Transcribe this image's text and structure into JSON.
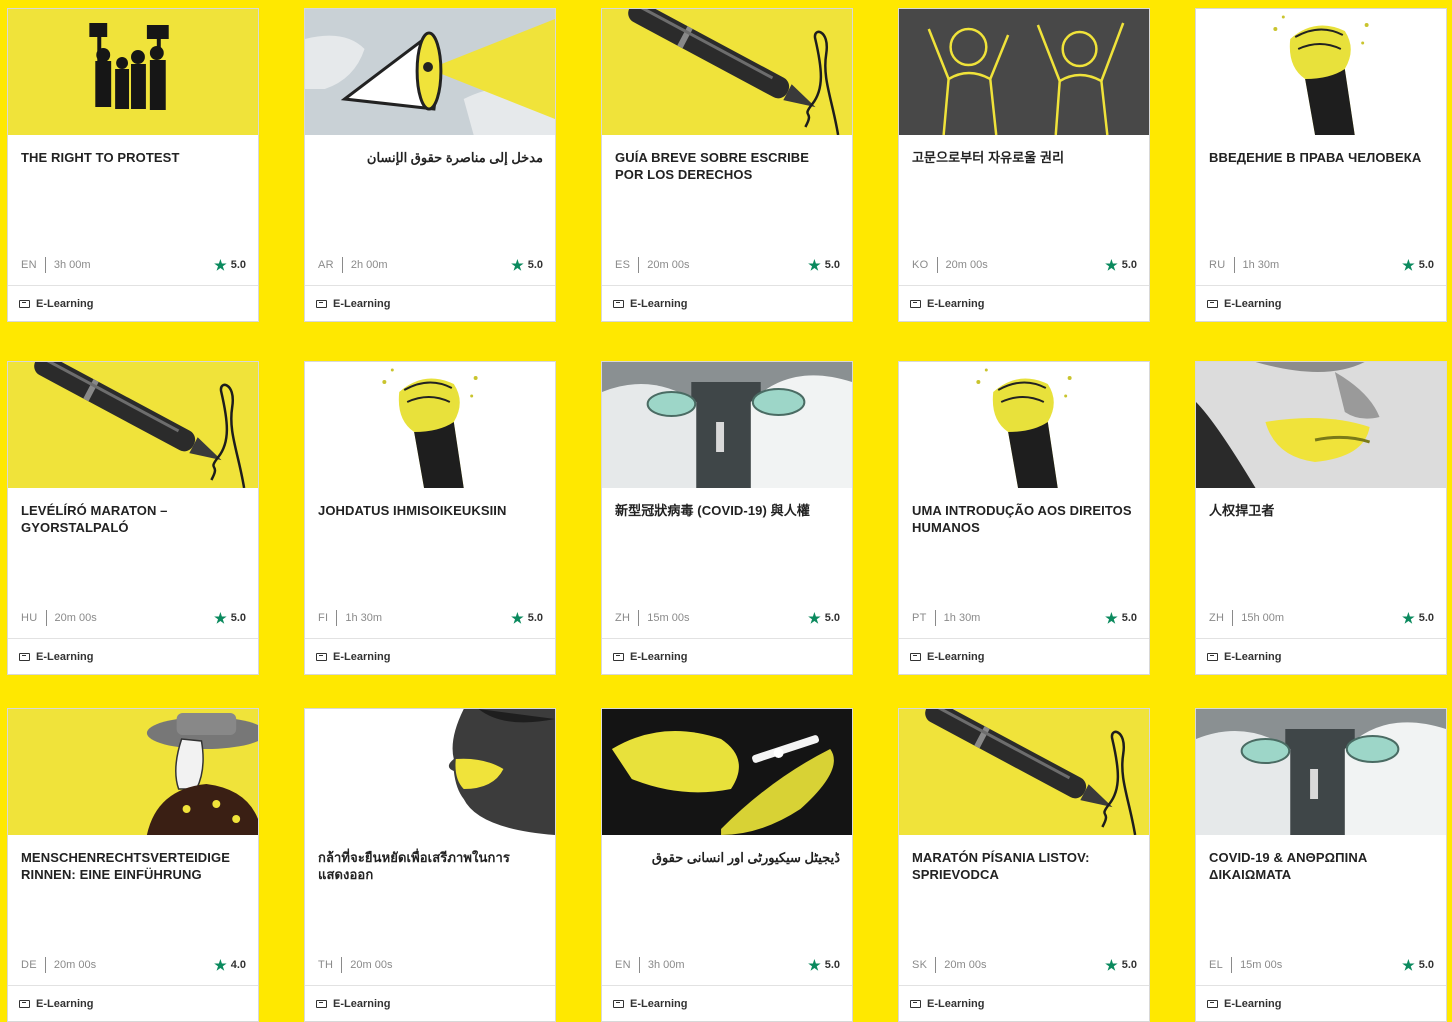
{
  "footer_label": "E-Learning",
  "colors": {
    "background": "#ffe800",
    "thumb_yellow": "#f0e33a",
    "star": "#0b8a5e"
  },
  "cards": [
    {
      "title": "THE RIGHT TO PROTEST",
      "lang": "EN",
      "duration": "3h 00m",
      "rating": "5.0",
      "image": "protesters-holding-signs"
    },
    {
      "title": "مدخل إلى مناصرة حقوق الإنسان",
      "lang": "AR",
      "duration": "2h 00m",
      "rating": "5.0",
      "image": "megaphone-map"
    },
    {
      "title": "GUÍA BREVE SOBRE ESCRIBE POR LOS DERECHOS",
      "lang": "ES",
      "duration": "20m 00s",
      "rating": "5.0",
      "image": "pen-writing"
    },
    {
      "title": "고문으로부터 자유로울 권리",
      "lang": "KO",
      "duration": "20m 00s",
      "rating": "5.0",
      "image": "prisoners-raised-arms"
    },
    {
      "title": "ВВЕДЕНИЕ В ПРАВА ЧЕЛОВЕКА",
      "lang": "RU",
      "duration": "1h 30m",
      "rating": "5.0",
      "image": "raised-fist"
    },
    {
      "title": "LEVÉLÍRÓ MARATON – GYORSTALPALÓ",
      "lang": "HU",
      "duration": "20m 00s",
      "rating": "5.0",
      "image": "pen-writing"
    },
    {
      "title": "JOHDATUS IHMISOIKEUKSIIN",
      "lang": "FI",
      "duration": "1h 30m",
      "rating": "5.0",
      "image": "raised-fist"
    },
    {
      "title": "新型冠狀病毒 (COVID-19) 與人權",
      "lang": "ZH",
      "duration": "15m 00s",
      "rating": "5.0",
      "image": "health-workers-ppe"
    },
    {
      "title": "UMA INTRODUÇÃO AOS DIREITOS HUMANOS",
      "lang": "PT",
      "duration": "1h 30m",
      "rating": "5.0",
      "image": "raised-fist"
    },
    {
      "title": "人权捍卫者",
      "lang": "ZH",
      "duration": "15h 00m",
      "rating": "5.0",
      "image": "face-yellow-paint"
    },
    {
      "title": "MENSCHENRECHTSVERTEIDIGE RINNEN: EINE EINFÜHRUNG",
      "lang": "DE",
      "duration": "20m 00s",
      "rating": "4.0",
      "image": "woman-hat-portrait"
    },
    {
      "title": "กล้าที่จะยืนหยัดเพื่อเสรีภาพในการแสดงออก",
      "lang": "TH",
      "duration": "20m 00s",
      "rating": "",
      "image": "man-profile-yellow"
    },
    {
      "title": "ڈیجیٹل سیکیورٹی اور انسانی حقوق",
      "lang": "EN",
      "duration": "3h 00m",
      "rating": "5.0",
      "image": "hands-phone-yellow"
    },
    {
      "title": "MARATÓN PÍSANIA LISTOV: SPRIEVODCA",
      "lang": "SK",
      "duration": "20m 00s",
      "rating": "5.0",
      "image": "pen-writing"
    },
    {
      "title": "COVID-19 & ΑΝΘΡΩΠΙΝΑ ΔΙΚΑΙΩΜΑΤΑ",
      "lang": "EL",
      "duration": "15m 00s",
      "rating": "5.0",
      "image": "health-workers-ppe"
    }
  ]
}
